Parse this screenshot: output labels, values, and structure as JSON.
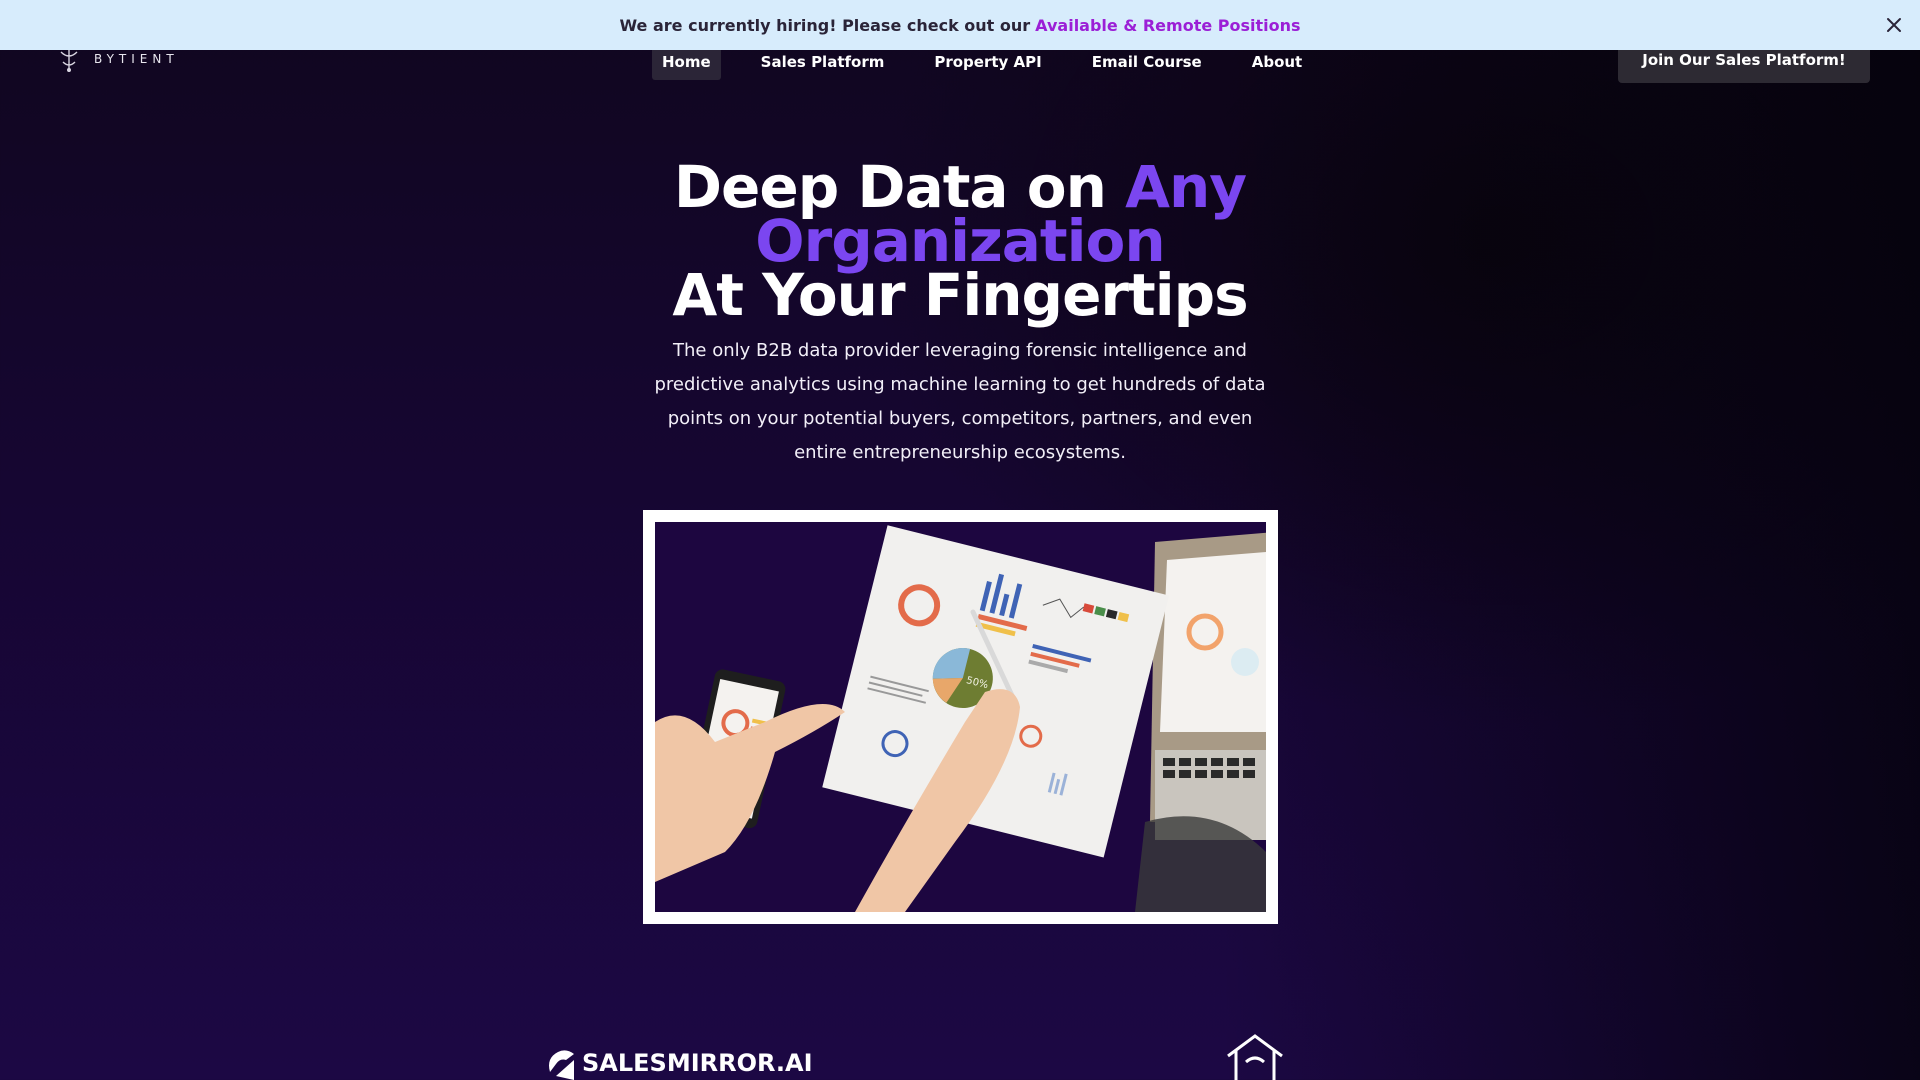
{
  "banner": {
    "message": "We are currently hiring! Please check out our",
    "link_text": "Available & Remote Positions",
    "close_icon": "close-icon"
  },
  "header": {
    "logo_text": "BYTIENT",
    "nav": [
      {
        "label": "Home",
        "active": true
      },
      {
        "label": "Sales Platform",
        "active": false
      },
      {
        "label": "Property API",
        "active": false
      },
      {
        "label": "Email Course",
        "active": false
      },
      {
        "label": "About",
        "active": false
      }
    ],
    "cta_label": "Join Our Sales Platform!"
  },
  "hero": {
    "title_part1": "Deep Data on",
    "title_accent": "Any Organization",
    "title_part2": "At Your Fingertips",
    "subtitle": "The only B2B data provider leveraging forensic intelligence and predictive analytics using machine learning to get hundreds of data points on your potential buyers, competitors, partners, and even entire entrepreneurship ecosystems.",
    "image_pie_label": "50%"
  },
  "partners": {
    "first_logo_text": "SALESMIRROR.AI",
    "second_logo_icon": "house-icon"
  },
  "colors": {
    "banner_bg": "#d7ecfc",
    "banner_link": "#9b1fd6",
    "accent": "#7b46f0",
    "page_bg": "#160632"
  }
}
